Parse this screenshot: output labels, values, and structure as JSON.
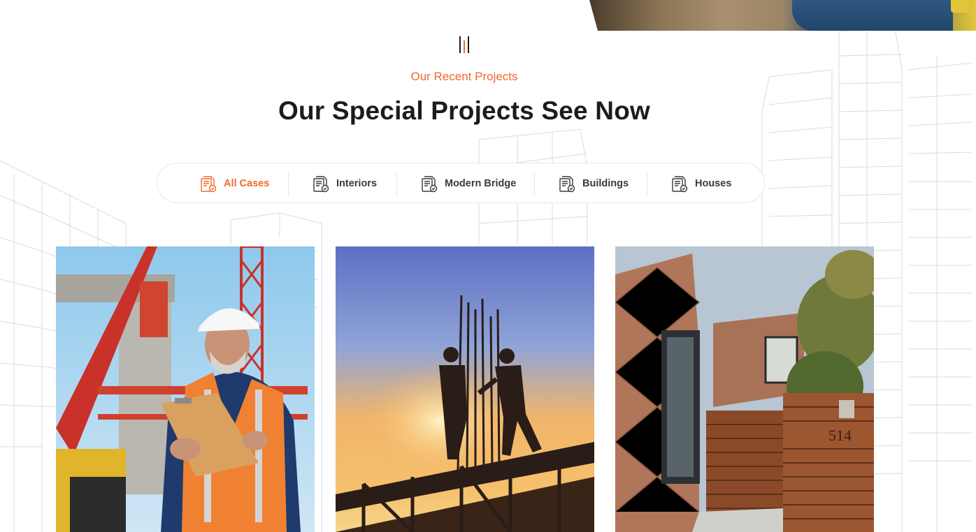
{
  "section": {
    "subtitle": "Our Recent Projects",
    "title": "Our Special Projects See Now"
  },
  "filters": [
    {
      "label": "All Cases",
      "icon": "document-check-icon",
      "active": true
    },
    {
      "label": "Interiors",
      "icon": "document-check-icon",
      "active": false
    },
    {
      "label": "Modern Bridge",
      "icon": "document-check-icon",
      "active": false
    },
    {
      "label": "Buildings",
      "icon": "document-check-icon",
      "active": false
    },
    {
      "label": "Houses",
      "icon": "document-check-icon",
      "active": false
    }
  ],
  "projects": [
    {
      "image": "engineer-with-clipboard"
    },
    {
      "image": "workers-silhouette-sunset"
    },
    {
      "image": "modern-house-exterior",
      "house_number": "514"
    }
  ],
  "colors": {
    "accent": "#f06a2c",
    "heading": "#1c1c1c",
    "border": "#e6e6ea"
  }
}
